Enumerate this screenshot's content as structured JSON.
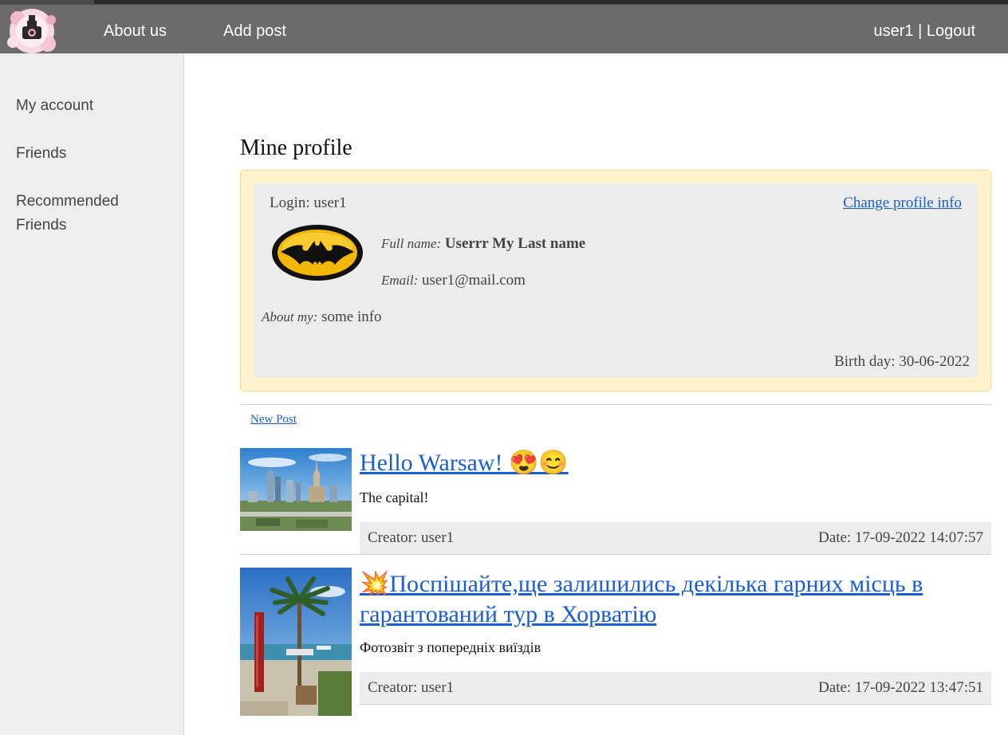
{
  "nav": {
    "about_us": "About us",
    "add_post": "Add post",
    "username": "user1",
    "separator": " | ",
    "logout": "Logout"
  },
  "sidebar": {
    "items": [
      {
        "label": "My account"
      },
      {
        "label": "Friends"
      },
      {
        "label": "Recommended Friends"
      }
    ]
  },
  "profile": {
    "page_title": "Mine profile",
    "login_label": "Login: ",
    "login": "user1",
    "change_link": "Change profile info",
    "full_name_label": "Full name:",
    "full_name": "Userrr My Last name",
    "email_label": "Email:",
    "email": "user1@mail.com",
    "about_label": "About my:",
    "about": "some info",
    "birthday_label": "Birth day: ",
    "birthday": "30-06-2022"
  },
  "new_post_link": "New Post",
  "posts": [
    {
      "title": "Hello Warsaw! 😍😊",
      "description": "The capital!",
      "creator_label": "Creator: ",
      "creator": "user1",
      "date_label": "Date: ",
      "date": "17-09-2022 14:07:57"
    },
    {
      "title": "💥Поспішайте,ще залишились декілька гарних місць в гарантований тур в Хорватію",
      "description": "Фотозвіт з попередніх виїздів",
      "creator_label": "Creator: ",
      "creator": "user1",
      "date_label": "Date: ",
      "date": "17-09-2022 13:47:51"
    }
  ],
  "colors": {
    "navbar": "#6b6b6b",
    "sidebar": "#eeeeee",
    "link": "#1a5fd0",
    "profile_outer": "#fff2cc",
    "profile_inner": "#ececec"
  }
}
